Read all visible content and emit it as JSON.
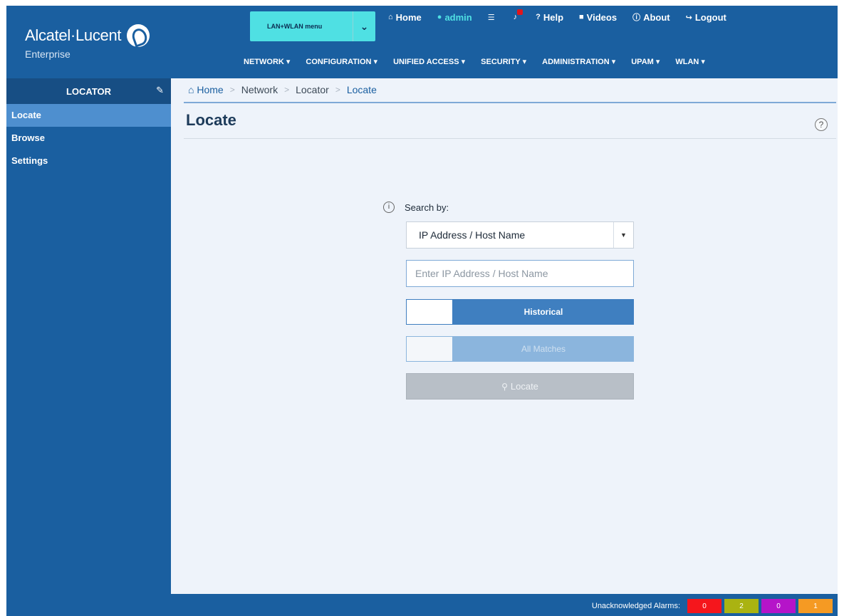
{
  "header": {
    "logo_brand": "Alcatel·Lucent",
    "logo_sub": "Enterprise",
    "menu_select": "LAN+WLAN menu",
    "top_links": [
      {
        "label": "Home",
        "icon": "home-icon"
      },
      {
        "label": "admin",
        "icon": "user-icon"
      },
      {
        "label": "",
        "icon": "list-icon"
      },
      {
        "label": "",
        "icon": "alarm-bell-icon"
      },
      {
        "label": "Help",
        "icon": "question-icon"
      },
      {
        "label": "Videos",
        "icon": "video-icon"
      },
      {
        "label": "About",
        "icon": "info-icon"
      },
      {
        "label": "Logout",
        "icon": "logout-icon"
      }
    ],
    "main_nav": [
      "NETWORK ▾",
      "CONFIGURATION ▾",
      "UNIFIED ACCESS ▾",
      "SECURITY ▾",
      "ADMINISTRATION ▾",
      "UPAM ▾",
      "WLAN ▾"
    ]
  },
  "sidebar": {
    "title": "LOCATOR",
    "items": [
      {
        "label": "Locate",
        "active": true
      },
      {
        "label": "Browse",
        "active": false
      },
      {
        "label": "Settings",
        "active": false
      }
    ]
  },
  "breadcrumb": [
    "Home",
    "Network",
    "Locator",
    "Locate"
  ],
  "page": {
    "title": "Locate",
    "help": "?"
  },
  "form": {
    "search_label": "Search by:",
    "search_by_value": "IP Address / Host Name",
    "input_placeholder": "Enter IP Address / Host Name",
    "historical_label": "Historical",
    "all_matches_label": "All Matches",
    "locate_label": "Locate"
  },
  "footer": {
    "alarms_label": "Unacknowledged Alarms:",
    "alarms": [
      {
        "count": "0",
        "color": "#f5161c"
      },
      {
        "count": "2",
        "color": "#aab311"
      },
      {
        "count": "0",
        "color": "#b514c9"
      },
      {
        "count": "1",
        "color": "#f59a23"
      }
    ]
  },
  "colors": {
    "accent": "#1a5fa0",
    "menu_select_bg": "#4fe0e3",
    "toggle_blue": "#3f7fc0",
    "content_bg": "#eef3fa"
  }
}
